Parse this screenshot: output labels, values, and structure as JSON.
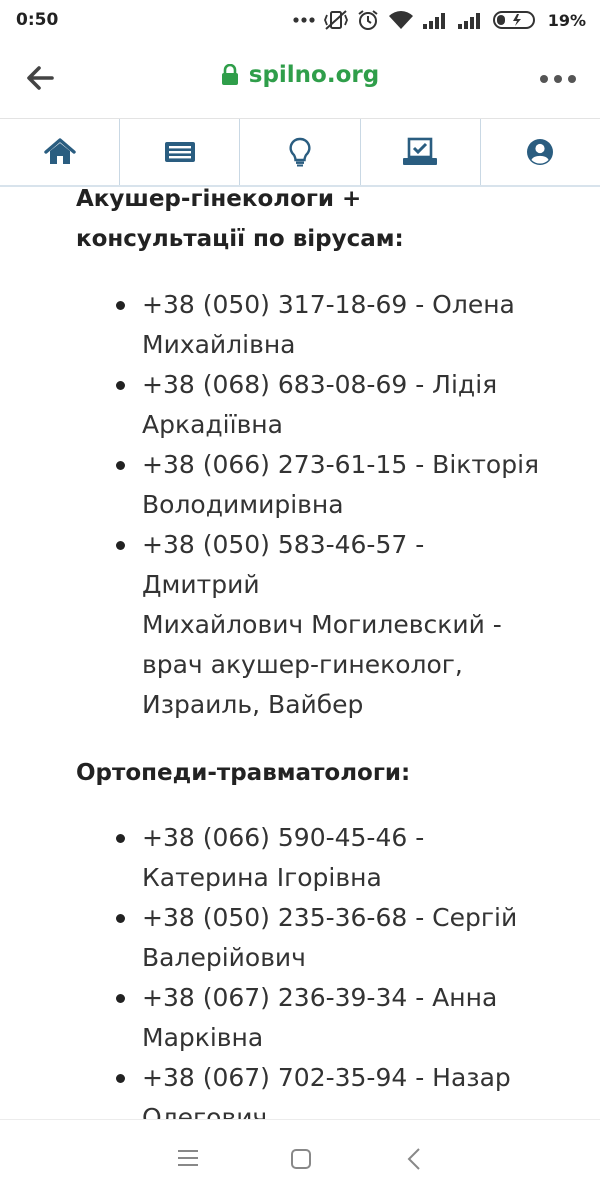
{
  "status_bar": {
    "time": "0:50",
    "battery": "19%"
  },
  "browser": {
    "url": "spilno.org"
  },
  "site_nav": {
    "items": [
      {
        "name": "home",
        "icon": "home-icon"
      },
      {
        "name": "news",
        "icon": "newspaper-icon"
      },
      {
        "name": "ideas",
        "icon": "lightbulb-icon"
      },
      {
        "name": "vote",
        "icon": "ballot-icon"
      },
      {
        "name": "profile",
        "icon": "user-icon"
      }
    ],
    "accent": "#2a5d80"
  },
  "sections": [
    {
      "heading_lines": [
        "Акушер-гінекологи +",
        "консультації по вірусам:"
      ],
      "items": [
        {
          "lines": [
            "+38 (050) 317-18-69 - Олена",
            "Михайлівна"
          ]
        },
        {
          "lines": [
            "+38 (068) 683-08-69 - Лідія",
            "Аркадіївна"
          ]
        },
        {
          "lines": [
            "+38 (066) 273-61-15 - Вікторія",
            "Володимирівна"
          ]
        },
        {
          "lines": [
            "+38 (050) 583-46-57 -",
            "Дмитрий",
            "Михайлович Могилевский -",
            "врач акушер-гинеколог,",
            "Израиль, Вайбер"
          ]
        }
      ]
    },
    {
      "heading_lines": [
        "Ортопеди-травматологи:"
      ],
      "items": [
        {
          "lines": [
            "+38 (066) 590-45-46 -",
            "Катерина Ігорівна"
          ]
        },
        {
          "lines": [
            "+38 (050) 235-36-68 - Сергій",
            "Валерійович"
          ]
        },
        {
          "lines": [
            "+38 (067) 236-39-34 - Анна",
            "Марківна"
          ]
        },
        {
          "lines": [
            "+38 (067) 702-35-94 - Назар",
            "Олегович"
          ]
        }
      ]
    }
  ]
}
